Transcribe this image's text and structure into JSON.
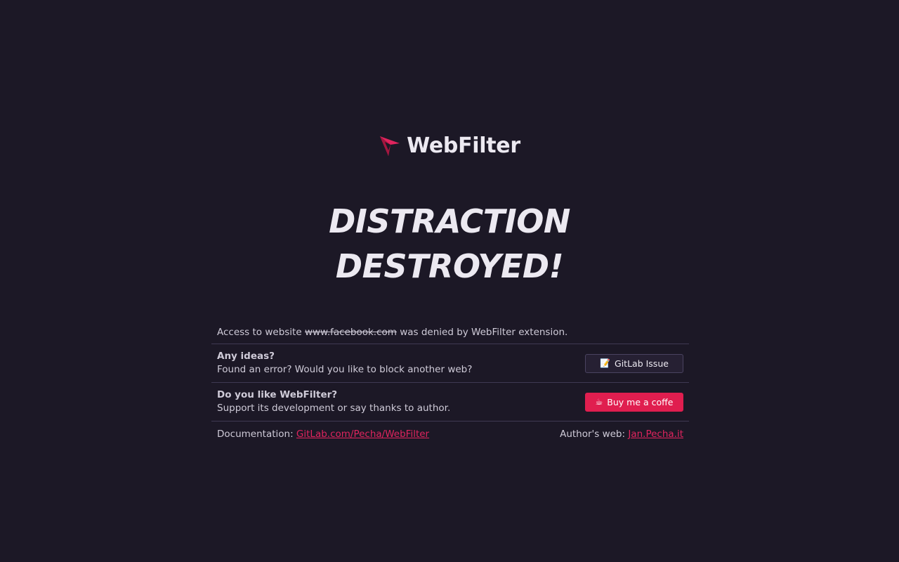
{
  "brand": {
    "name": "WebFilter",
    "accent_color": "#e0245e",
    "logo_icon": "arrow-cursor-icon"
  },
  "headline": {
    "line1": "DISTRACTION",
    "line2": "DESTROYED!"
  },
  "notice": {
    "prefix": "Access to website",
    "blocked_site": "www.facebook.com",
    "suffix": "was denied by WebFilter extension."
  },
  "ideas": {
    "title": "Any ideas?",
    "text": "Found an error? Would you like to block another web?",
    "button_icon": "memo-icon",
    "button_glyph": "📝",
    "button_label": "GitLab Issue"
  },
  "support": {
    "title": "Do you like WebFilter?",
    "text": "Support its development or say thanks to author.",
    "button_icon": "coffee-icon",
    "button_glyph": "☕",
    "button_label": "Buy me a coffe"
  },
  "footer": {
    "docs_label": "Documentation:",
    "docs_link": "GitLab.com/Pecha/WebFilter",
    "author_label": "Author's web:",
    "author_link": "Jan.Pecha.it"
  }
}
